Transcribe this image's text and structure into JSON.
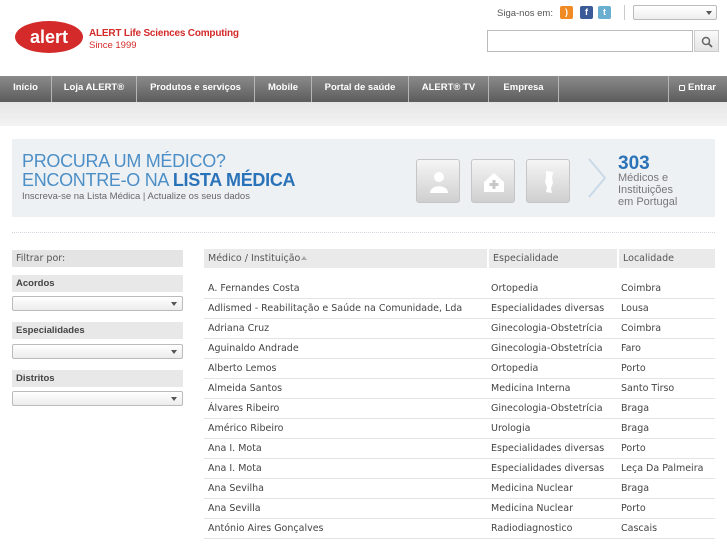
{
  "header": {
    "brand_name": "ALERT Life Sciences Computing",
    "brand_sub": "Since 1999",
    "logo_text": "alert",
    "follow_label": "Siga-nos em:",
    "language_select_value": "",
    "search_placeholder": ""
  },
  "nav": {
    "items": [
      {
        "label": "Início"
      },
      {
        "label": "Loja ALERT®"
      },
      {
        "label": "Produtos e serviços"
      },
      {
        "label": "Mobile"
      },
      {
        "label": "Portal de saúde"
      },
      {
        "label": "ALERT® TV"
      },
      {
        "label": "Empresa"
      }
    ],
    "login_label": "Entrar"
  },
  "banner": {
    "line1": "PROCURA UM MÉDICO?",
    "line2_prefix": "ENCONTRE-O NA ",
    "line2_bold": "LISTA MÉDICA",
    "subline": "Inscreva-se na Lista Médica | Actualize os seus dados",
    "count": "303",
    "count_label_1": "Médicos e",
    "count_label_2": "Instituições",
    "count_label_3": "em Portugal"
  },
  "filters": {
    "heading": "Filtrar por:",
    "groups": [
      {
        "title": "Acordos",
        "value": ""
      },
      {
        "title": "Especialidades",
        "value": ""
      },
      {
        "title": "Distritos",
        "value": ""
      }
    ]
  },
  "table": {
    "columns": [
      "Médico / Instituição",
      "Especialidade",
      "Localidade"
    ],
    "rows": [
      [
        "A. Fernandes Costa",
        "Ortopedia",
        "Coimbra"
      ],
      [
        "Adlismed - Reabilitação e Saúde na Comunidade, Lda",
        "Especialidades diversas",
        "Lousa"
      ],
      [
        "Adriana Cruz",
        "Ginecologia-Obstetrícia",
        "Coimbra"
      ],
      [
        "Aguinaldo Andrade",
        "Ginecologia-Obstetrícia",
        "Faro"
      ],
      [
        "Alberto Lemos",
        "Ortopedia",
        "Porto"
      ],
      [
        "Almeida Santos",
        "Medicina Interna",
        "Santo Tirso"
      ],
      [
        "Álvares Ribeiro",
        "Ginecologia-Obstetrícia",
        "Braga"
      ],
      [
        "Américo Ribeiro",
        "Urologia",
        "Braga"
      ],
      [
        "Ana I. Mota",
        "Especialidades diversas",
        "Porto"
      ],
      [
        "Ana I. Mota",
        "Especialidades diversas",
        "Leça Da Palmeira"
      ],
      [
        "Ana Sevilha",
        "Medicina Nuclear",
        "Braga"
      ],
      [
        "Ana Sevilla",
        "Medicina Nuclear",
        "Porto"
      ],
      [
        "António Aires Gonçalves",
        "Radiodiagnostico",
        "Cascais"
      ]
    ]
  },
  "colors": {
    "brand_red": "#d42a2a",
    "banner_blue": "#2b73b8",
    "nav_gray": "#6e6e6e"
  }
}
